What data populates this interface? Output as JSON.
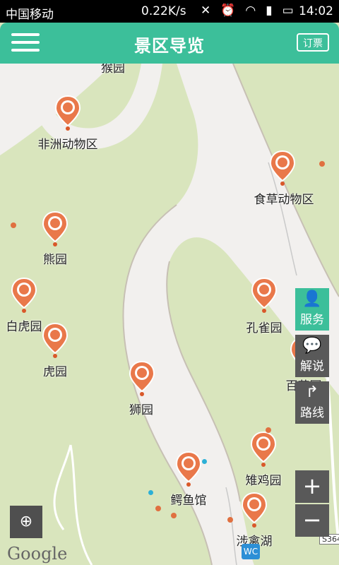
{
  "status_bar": {
    "carrier": "中国移动",
    "speed": "0.22K/s",
    "time": "14:02"
  },
  "app_bar": {
    "title": "景区导览",
    "ticket_label": "订票"
  },
  "map": {
    "labels": {
      "monkey_park": "猴园",
      "africa": "非洲动物区",
      "herbivore": "食草动物区",
      "bear": "熊园",
      "white_tiger": "白虎园",
      "tiger": "虎园",
      "lion": "狮园",
      "peacock": "孔雀园",
      "hundred_flowers": "百花园",
      "pheasant": "雉鸡园",
      "crocodile": "鳄鱼馆",
      "waterfowl_lake": "涉禽湖"
    },
    "wc": "WC",
    "road_tag": "S364",
    "google": "Google"
  },
  "side_buttons": {
    "service": "服务",
    "commentary": "解说",
    "route": "路线"
  },
  "zoom": {
    "in": "+",
    "out": "−"
  },
  "colors": {
    "accent": "#3cbf9a",
    "pin": "#e9784a",
    "map_green": "#d9e5bd",
    "road": "#f2f0ee"
  }
}
